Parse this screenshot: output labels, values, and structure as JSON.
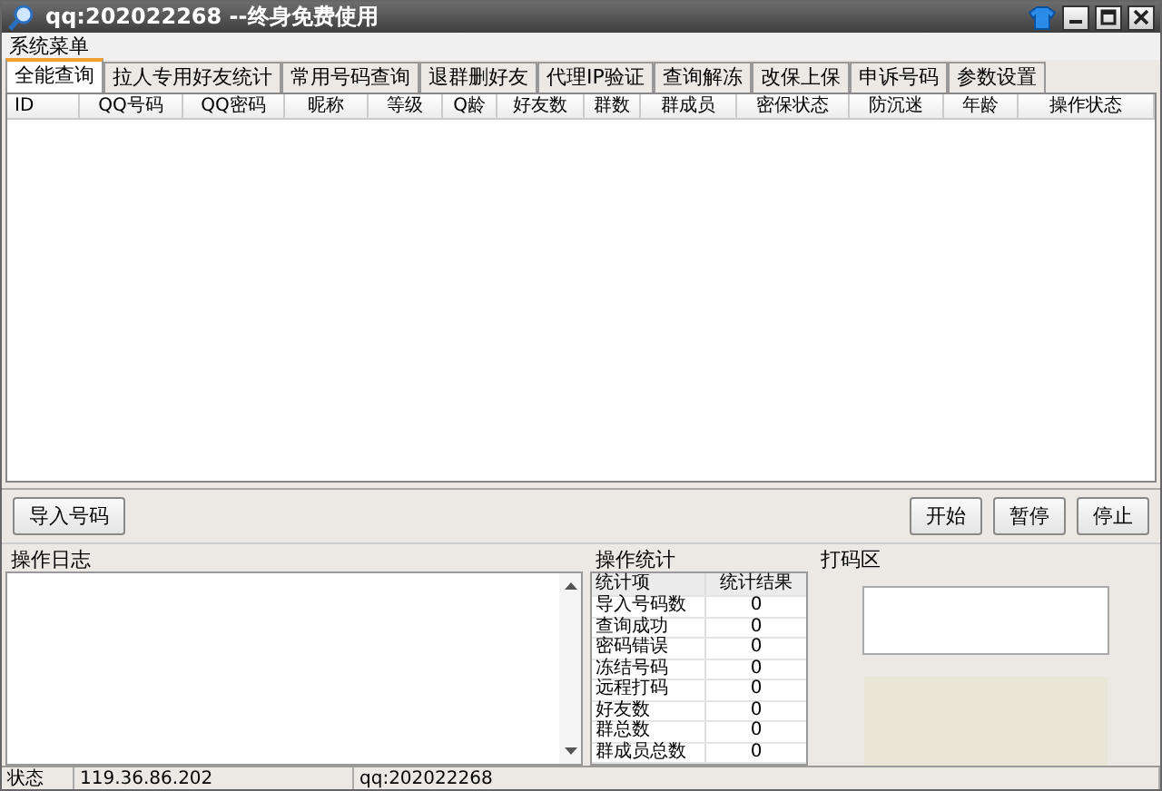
{
  "window": {
    "title": "qq:202022268 --终身免费使用"
  },
  "menu": [
    "系统菜单"
  ],
  "tabs": [
    {
      "label": "全能查询",
      "selected": true
    },
    {
      "label": "拉人专用好友统计",
      "selected": false
    },
    {
      "label": "常用号码查询",
      "selected": false
    },
    {
      "label": "退群删好友",
      "selected": false
    },
    {
      "label": "代理IP验证",
      "selected": false
    },
    {
      "label": "查询解冻",
      "selected": false
    },
    {
      "label": "改保上保",
      "selected": false
    },
    {
      "label": "申诉号码",
      "selected": false
    },
    {
      "label": "参数设置",
      "selected": false
    }
  ],
  "table": {
    "columns": [
      "ID",
      "QQ号码",
      "QQ密码",
      "昵称",
      "等级",
      "Q龄",
      "好友数",
      "群数",
      "群成员",
      "密保状态",
      "防沉迷",
      "年龄",
      "操作状态"
    ]
  },
  "toolbar": {
    "import_button": "导入号码",
    "buttons": [
      "开始",
      "暂停",
      "停止"
    ]
  },
  "log_panel": {
    "title": "操作日志"
  },
  "stats_panel": {
    "title": "操作统计",
    "columns": [
      "统计项",
      "统计结果"
    ],
    "rows": [
      {
        "item": "导入号码数",
        "result": "0"
      },
      {
        "item": "查询成功",
        "result": "0"
      },
      {
        "item": "密码错误",
        "result": "0"
      },
      {
        "item": "冻结号码",
        "result": "0"
      },
      {
        "item": "远程打码",
        "result": "0"
      },
      {
        "item": "好友数",
        "result": "0"
      },
      {
        "item": "群总数",
        "result": "0"
      },
      {
        "item": "群成员总数",
        "result": "0"
      }
    ]
  },
  "captcha_panel": {
    "title": "打码区"
  },
  "status_bar": [
    "状态",
    "119.36.86.202",
    "qq:202022268"
  ]
}
